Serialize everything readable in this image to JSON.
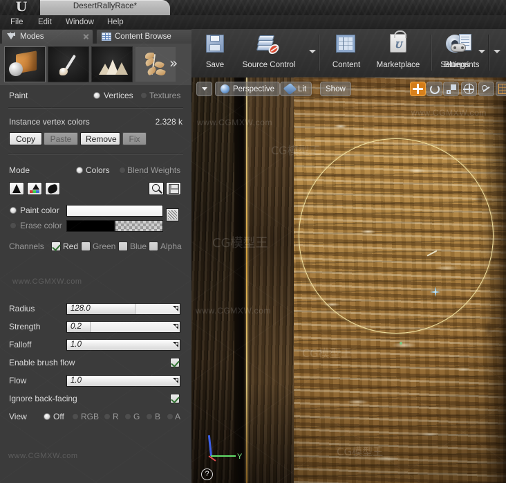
{
  "window": {
    "project_tab": "DesertRallyRace*",
    "logo": "unreal-engine-logo"
  },
  "menubar": {
    "items": [
      "File",
      "Edit",
      "Window",
      "Help"
    ]
  },
  "panel_tabs": [
    {
      "label": "Modes",
      "icon": "modes-icon",
      "active": true
    },
    {
      "label": "Content Browse",
      "icon": "content-browser-icon",
      "active": false
    }
  ],
  "mode_buttons": [
    {
      "name": "place-mode",
      "icon": "cube-sphere-icon",
      "active": true
    },
    {
      "name": "paint-mode",
      "icon": "paintbrush-icon",
      "active": false
    },
    {
      "name": "landscape-mode",
      "icon": "mountain-icon",
      "active": false
    },
    {
      "name": "foliage-mode",
      "icon": "leaf-icon",
      "active": false
    },
    {
      "name": "more-modes",
      "icon": "double-chevron-right-icon",
      "active": false
    }
  ],
  "toolbar": {
    "buttons": [
      {
        "label": "Save",
        "icon": "floppy-disk-icon",
        "caret": false
      },
      {
        "label": "Source Control",
        "icon": "source-control-icon",
        "caret": true
      },
      {
        "label": "Content",
        "icon": "content-grid-icon",
        "caret": false
      },
      {
        "label": "Marketplace",
        "icon": "shopping-bag-icon",
        "caret": false
      },
      {
        "label": "Settings",
        "icon": "gear-icon",
        "caret": true
      },
      {
        "label": "Blueprints",
        "icon": "blueprint-gamepad-icon",
        "caret": true
      }
    ]
  },
  "paint_panel": {
    "paint_label": "Paint",
    "paint_options": [
      {
        "label": "Vertices",
        "selected": true
      },
      {
        "label": "Textures",
        "selected": false
      }
    ],
    "instance_label": "Instance vertex colors",
    "instance_value": "2.328 k",
    "actions": [
      {
        "label": "Copy",
        "enabled": true
      },
      {
        "label": "Paste",
        "enabled": false
      },
      {
        "label": "Remove",
        "enabled": true
      },
      {
        "label": "Fix",
        "enabled": false
      }
    ],
    "mode_label": "Mode",
    "mode_options": [
      {
        "label": "Colors",
        "selected": true
      },
      {
        "label": "Blend Weights",
        "selected": false
      }
    ],
    "tool_icons": [
      {
        "name": "paint-bucket-icon"
      },
      {
        "name": "import-vertex-color-icon"
      },
      {
        "name": "fill-blob-icon"
      },
      {
        "name": "magnifier-icon"
      },
      {
        "name": "save-small-icon"
      }
    ],
    "paint_color": {
      "label": "Paint color",
      "selected": true,
      "color": "#ffffff"
    },
    "erase_color": {
      "label": "Erase color",
      "selected": false,
      "color": "#000000"
    },
    "swap_button": "swap-colors-icon",
    "channels_label": "Channels",
    "channels": [
      {
        "label": "Red",
        "checked": true
      },
      {
        "label": "Green",
        "checked": false
      },
      {
        "label": "Blue",
        "checked": false
      },
      {
        "label": "Alpha",
        "checked": false
      }
    ],
    "sliders": [
      {
        "label": "Radius",
        "value": "128.0",
        "fill_pct": 60
      },
      {
        "label": "Strength",
        "value": "0.2",
        "fill_pct": 20
      },
      {
        "label": "Falloff",
        "value": "1.0",
        "fill_pct": 100
      }
    ],
    "brush_flow": {
      "label": "Enable brush flow",
      "checked": true
    },
    "flow_slider": {
      "label": "Flow",
      "value": "1.0",
      "fill_pct": 100
    },
    "ignore_back_facing": {
      "label": "Ignore back-facing",
      "checked": true
    },
    "view_label": "View",
    "view_options": [
      {
        "label": "Off",
        "selected": true
      },
      {
        "label": "RGB",
        "selected": false
      },
      {
        "label": "R",
        "selected": false
      },
      {
        "label": "G",
        "selected": false
      },
      {
        "label": "B",
        "selected": false
      },
      {
        "label": "A",
        "selected": false
      }
    ]
  },
  "viewport": {
    "menu_caret": "viewport-options-caret",
    "camera_mode": "Perspective",
    "view_mode": "Lit",
    "show_menu": "Show",
    "transform_tools": [
      {
        "name": "translate-tool",
        "icon": "move-icon",
        "active": true
      },
      {
        "name": "rotate-tool",
        "icon": "rotate-icon",
        "active": false
      },
      {
        "name": "scale-tool",
        "icon": "scale-icon",
        "active": false
      },
      {
        "name": "world-coords-toggle",
        "icon": "globe-icon",
        "active": false
      },
      {
        "name": "surface-snap-toggle",
        "icon": "snap-icon",
        "active": false
      },
      {
        "name": "grid-snap-toggle",
        "icon": "grid-icon",
        "active": false
      }
    ],
    "axis_labels": {
      "y": "Y"
    },
    "help_button": "?",
    "brush_cursor": "paint-brush-circle",
    "accent_color": "#dd8118",
    "brush_outline_color": "#f2e2a0"
  },
  "watermarks": {
    "site": "www.CGMXW.com",
    "brand": "CG模型王"
  }
}
